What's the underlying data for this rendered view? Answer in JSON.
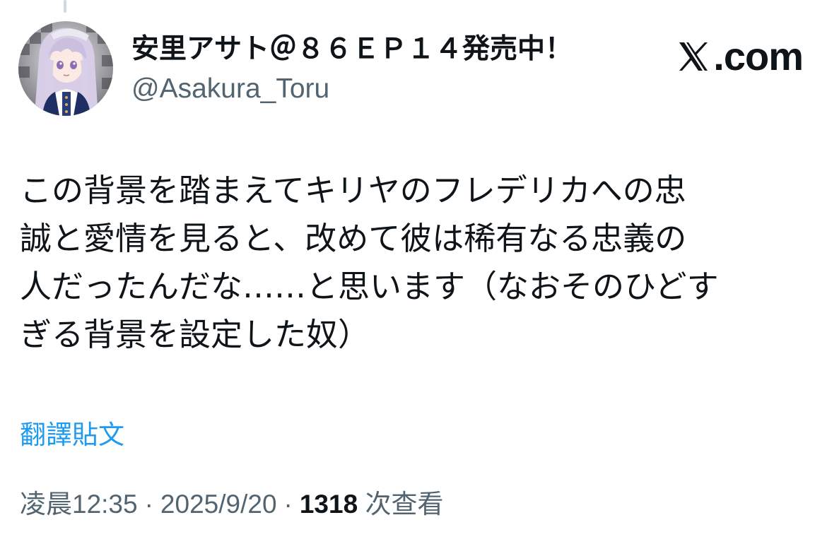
{
  "author": {
    "display_name": "安里アサト＠８６ＥＰ１４発売中！",
    "handle": "@Asakura_Toru"
  },
  "brand": {
    "label": ".com",
    "icon": "x-logo-icon"
  },
  "tweet": {
    "lines": [
      "この背景を踏まえてキリヤのフレデリカへの忠",
      "誠と愛情を見ると、改めて彼は稀有なる忠義の",
      "人だったんだな……と思います（なおそのひどす",
      "ぎる背景を設定した奴）"
    ]
  },
  "translate_label": "翻譯貼文",
  "meta": {
    "time": "凌晨12:35",
    "separator": "·",
    "date": "2025/9/20",
    "views_count": "1318",
    "views_label": "次查看"
  },
  "colors": {
    "text": "#0f1419",
    "secondary": "#536471",
    "link": "#1d9bf0",
    "background": "#ffffff"
  }
}
